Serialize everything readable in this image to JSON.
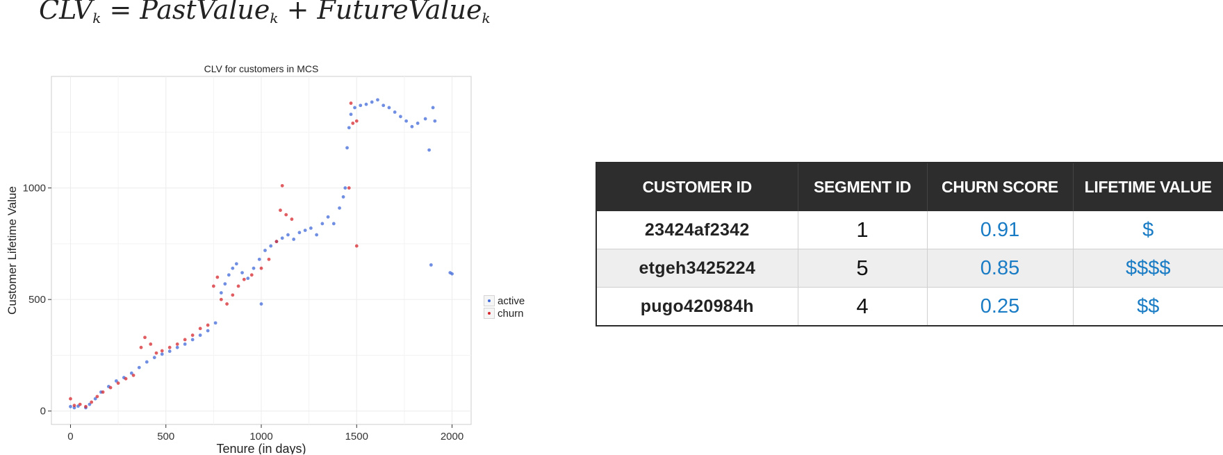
{
  "formula": {
    "lhs": "CLV",
    "lhs_sub": "k",
    "eq": " = ",
    "term1": "PastValue",
    "term1_sub": "k",
    "plus": " + ",
    "term2": "FutureValue",
    "term2_sub": "k"
  },
  "chart_data": {
    "type": "scatter",
    "title": "CLV for customers in MCS",
    "xlabel": "Tenure (in days)",
    "ylabel": "Customer Lifetime Value",
    "xlim": [
      -100,
      2100
    ],
    "ylim": [
      -60,
      1500
    ],
    "xticks": [
      0,
      500,
      1000,
      1500,
      2000
    ],
    "yticks": [
      0,
      500,
      1000
    ],
    "grid": true,
    "legend_position": "right",
    "series": [
      {
        "name": "active",
        "color": "#4169d8",
        "points": [
          [
            0,
            20
          ],
          [
            20,
            15
          ],
          [
            40,
            22
          ],
          [
            80,
            15
          ],
          [
            100,
            30
          ],
          [
            130,
            55
          ],
          [
            160,
            85
          ],
          [
            200,
            110
          ],
          [
            240,
            135
          ],
          [
            280,
            150
          ],
          [
            320,
            170
          ],
          [
            360,
            195
          ],
          [
            400,
            220
          ],
          [
            440,
            240
          ],
          [
            480,
            255
          ],
          [
            520,
            268
          ],
          [
            560,
            285
          ],
          [
            600,
            300
          ],
          [
            640,
            320
          ],
          [
            680,
            340
          ],
          [
            720,
            360
          ],
          [
            760,
            395
          ],
          [
            790,
            530
          ],
          [
            810,
            570
          ],
          [
            830,
            610
          ],
          [
            850,
            640
          ],
          [
            870,
            660
          ],
          [
            900,
            620
          ],
          [
            930,
            595
          ],
          [
            960,
            640
          ],
          [
            990,
            680
          ],
          [
            1020,
            720
          ],
          [
            1050,
            740
          ],
          [
            1080,
            760
          ],
          [
            1110,
            775
          ],
          [
            1140,
            790
          ],
          [
            1170,
            770
          ],
          [
            1200,
            800
          ],
          [
            1230,
            810
          ],
          [
            1260,
            820
          ],
          [
            1290,
            790
          ],
          [
            1320,
            840
          ],
          [
            1350,
            870
          ],
          [
            1380,
            840
          ],
          [
            1410,
            910
          ],
          [
            1430,
            960
          ],
          [
            1440,
            1000
          ],
          [
            1450,
            1180
          ],
          [
            1460,
            1270
          ],
          [
            1470,
            1330
          ],
          [
            1490,
            1360
          ],
          [
            1520,
            1370
          ],
          [
            1550,
            1375
          ],
          [
            1580,
            1385
          ],
          [
            1610,
            1395
          ],
          [
            1640,
            1370
          ],
          [
            1670,
            1360
          ],
          [
            1700,
            1340
          ],
          [
            1730,
            1320
          ],
          [
            1760,
            1300
          ],
          [
            1790,
            1275
          ],
          [
            1820,
            1290
          ],
          [
            1860,
            1310
          ],
          [
            1900,
            1360
          ],
          [
            1910,
            1300
          ],
          [
            1880,
            1170
          ],
          [
            1890,
            655
          ],
          [
            1990,
            620
          ],
          [
            2000,
            615
          ],
          [
            1000,
            480
          ]
        ]
      },
      {
        "name": "churn",
        "color": "#d6272e",
        "points": [
          [
            0,
            55
          ],
          [
            20,
            25
          ],
          [
            50,
            30
          ],
          [
            80,
            20
          ],
          [
            110,
            40
          ],
          [
            140,
            65
          ],
          [
            170,
            85
          ],
          [
            210,
            105
          ],
          [
            250,
            125
          ],
          [
            290,
            145
          ],
          [
            330,
            160
          ],
          [
            370,
            285
          ],
          [
            390,
            330
          ],
          [
            420,
            300
          ],
          [
            450,
            260
          ],
          [
            480,
            270
          ],
          [
            520,
            285
          ],
          [
            560,
            300
          ],
          [
            600,
            320
          ],
          [
            640,
            340
          ],
          [
            680,
            370
          ],
          [
            720,
            385
          ],
          [
            750,
            560
          ],
          [
            770,
            600
          ],
          [
            790,
            500
          ],
          [
            820,
            480
          ],
          [
            850,
            520
          ],
          [
            880,
            560
          ],
          [
            910,
            590
          ],
          [
            950,
            610
          ],
          [
            1000,
            640
          ],
          [
            1040,
            680
          ],
          [
            1080,
            760
          ],
          [
            1100,
            900
          ],
          [
            1110,
            1010
          ],
          [
            1130,
            880
          ],
          [
            1160,
            860
          ],
          [
            1500,
            740
          ],
          [
            1460,
            1000
          ],
          [
            1470,
            1380
          ],
          [
            1480,
            1290
          ],
          [
            1500,
            1300
          ]
        ]
      }
    ]
  },
  "table": {
    "headers": [
      "CUSTOMER ID",
      "SEGMENT ID",
      "CHURN SCORE",
      "LIFETIME VALUE"
    ],
    "rows": [
      {
        "customer_id": "23424af2342",
        "segment_id": "1",
        "churn_score": "0.91",
        "lifetime_value": "$"
      },
      {
        "customer_id": "etgeh3425224",
        "segment_id": "5",
        "churn_score": "0.85",
        "lifetime_value": "$$$$"
      },
      {
        "customer_id": "pugo420984h",
        "segment_id": "4",
        "churn_score": "0.25",
        "lifetime_value": "$$"
      }
    ]
  }
}
